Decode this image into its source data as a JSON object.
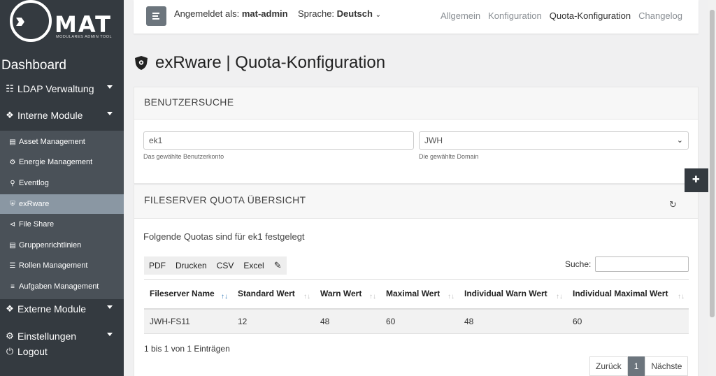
{
  "logo": {
    "text": "MAT",
    "subtitle": "MODULARES ADMIN TOOL"
  },
  "sidebar": {
    "dashboard": "Dashboard",
    "groups": [
      {
        "label": "LDAP Verwaltung",
        "icon": "sitemap-icon"
      },
      {
        "label": "Interne Module",
        "icon": "cubes-icon"
      },
      {
        "label": "Externe Module",
        "icon": "external-cubes-icon"
      },
      {
        "label": "Einstellungen",
        "icon": "gear-icon"
      }
    ],
    "sub_items": [
      {
        "label": "Asset Management",
        "icon": "server-icon"
      },
      {
        "label": "Energie Management",
        "icon": "energy-icon"
      },
      {
        "label": "Eventlog",
        "icon": "search-icon"
      },
      {
        "label": "exRware",
        "icon": "shield-icon"
      },
      {
        "label": "File Share",
        "icon": "share-icon"
      },
      {
        "label": "Gruppenrichtlinien",
        "icon": "document-icon"
      },
      {
        "label": "Rollen Management",
        "icon": "layers-icon"
      },
      {
        "label": "Aufgaben Management",
        "icon": "tasks-icon"
      }
    ],
    "active_sub": "exRware",
    "logout": "Logout"
  },
  "topbar": {
    "login_prefix": "Angemeldet als:",
    "login_user": "mat-admin",
    "lang_prefix": "Sprache:",
    "lang_value": "Deutsch",
    "links": [
      "Allgemein",
      "Konfiguration",
      "Quota-Konfiguration",
      "Changelog"
    ],
    "active_link": "Quota-Konfiguration"
  },
  "page": {
    "title": "exRware | Quota-Konfiguration"
  },
  "user_search": {
    "header": "BENUTZERSUCHE",
    "account_value": "ek1",
    "account_help": "Das gewählte Benutzerkonto",
    "domain_value": "JWH",
    "domain_help": "Die gewählte Domain"
  },
  "quota": {
    "header": "FILESERVER QUOTA ÜBERSICHT",
    "intro": "Folgende Quotas sind für ek1 festgelegt",
    "buttons": [
      "PDF",
      "Drucken",
      "CSV",
      "Excel"
    ],
    "search_label": "Suche:",
    "columns": [
      "Fileserver Name",
      "Standard Wert",
      "Warn Wert",
      "Maximal Wert",
      "Individual Warn Wert",
      "Individual Maximal Wert"
    ],
    "rows": [
      [
        "JWH-FS11",
        "12",
        "48",
        "60",
        "48",
        "60"
      ]
    ],
    "info": "1 bis 1 von 1 Einträgen",
    "pager": {
      "prev": "Zurück",
      "page": "1",
      "next": "Nächste"
    }
  }
}
